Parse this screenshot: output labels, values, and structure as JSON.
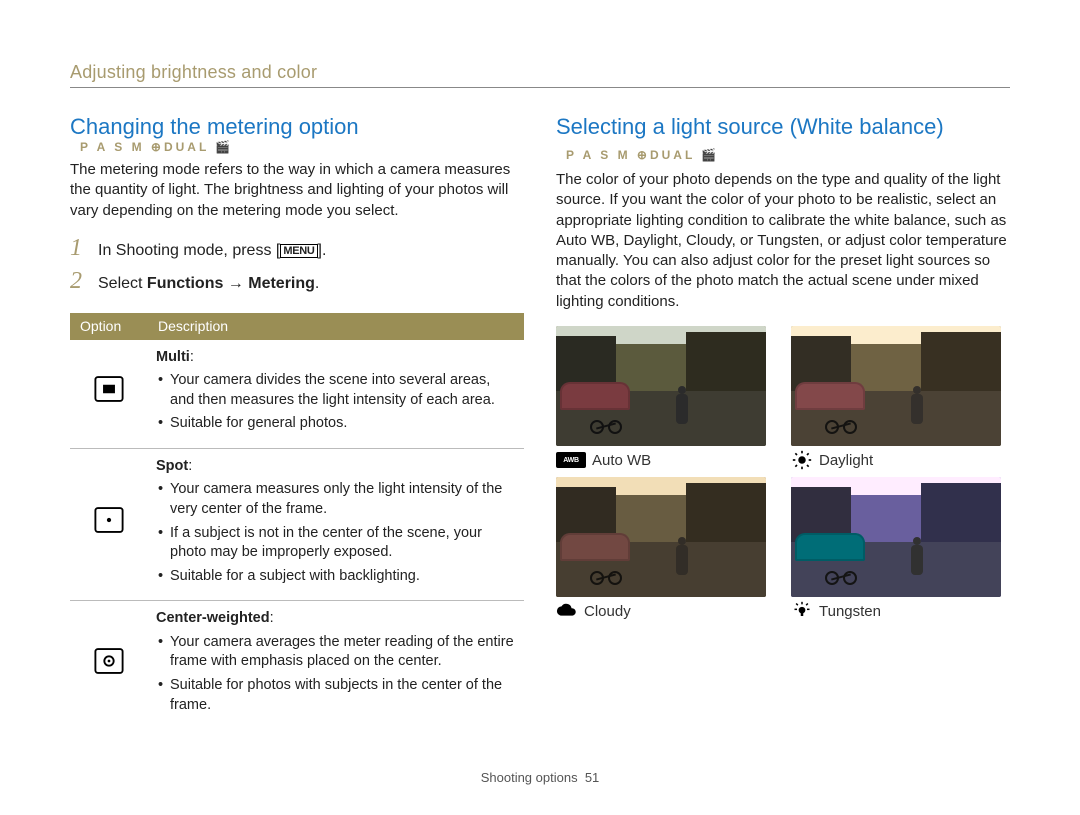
{
  "page_header": "Adjusting brightness and color",
  "footer": {
    "section": "Shooting options",
    "page": "51"
  },
  "modes_string": "P A S M ⊕DUAL 🎬",
  "left": {
    "title": "Changing the metering option",
    "intro": "The metering mode refers to the way in which a camera measures the quantity of light. The brightness and lighting of your photos will vary depending on the metering mode you select.",
    "steps": {
      "s1_pre": "In Shooting mode, press [",
      "s1_menu": "MENU",
      "s1_post": "].",
      "s2_pre": "Select ",
      "s2_b1": "Functions",
      "s2_arrow": " → ",
      "s2_b2": "Metering",
      "s2_post": "."
    },
    "table": {
      "head_option": "Option",
      "head_desc": "Description",
      "rows": [
        {
          "icon": "metering-multi-icon",
          "name": "Multi",
          "bullets": [
            "Your camera divides the scene into several areas, and then measures the light intensity of each area.",
            "Suitable for general photos."
          ]
        },
        {
          "icon": "metering-spot-icon",
          "name": "Spot",
          "bullets": [
            "Your camera measures only the light intensity of the very center of the frame.",
            "If a subject is not in the center of the scene, your photo may be improperly exposed.",
            "Suitable for a subject with backlighting."
          ]
        },
        {
          "icon": "metering-center-icon",
          "name": "Center-weighted",
          "bullets": [
            "Your camera averages the meter reading of the entire frame with emphasis placed on the center.",
            "Suitable for photos with subjects in the center of the frame."
          ]
        }
      ]
    }
  },
  "right": {
    "title": "Selecting a light source (White balance)",
    "intro": "The color of your photo depends on the type and quality of the light source. If you want the color of your photo to be realistic, select an appropriate lighting condition to calibrate the white balance, such as Auto WB, Daylight, Cloudy, or Tungsten, or adjust color temperature manually. You can also adjust color for the preset light sources so that the colors of the photo match the actual scene under mixed lighting conditions.",
    "samples": [
      {
        "icon": "awb-icon",
        "icon_text": "AWB",
        "label": "Auto WB",
        "class": "auto"
      },
      {
        "icon": "daylight-icon",
        "icon_text": "",
        "label": "Daylight",
        "class": "daylight"
      },
      {
        "icon": "cloudy-icon",
        "icon_text": "",
        "label": "Cloudy",
        "class": "cloudy"
      },
      {
        "icon": "tungsten-icon",
        "icon_text": "",
        "label": "Tungsten",
        "class": "tungsten"
      }
    ]
  }
}
